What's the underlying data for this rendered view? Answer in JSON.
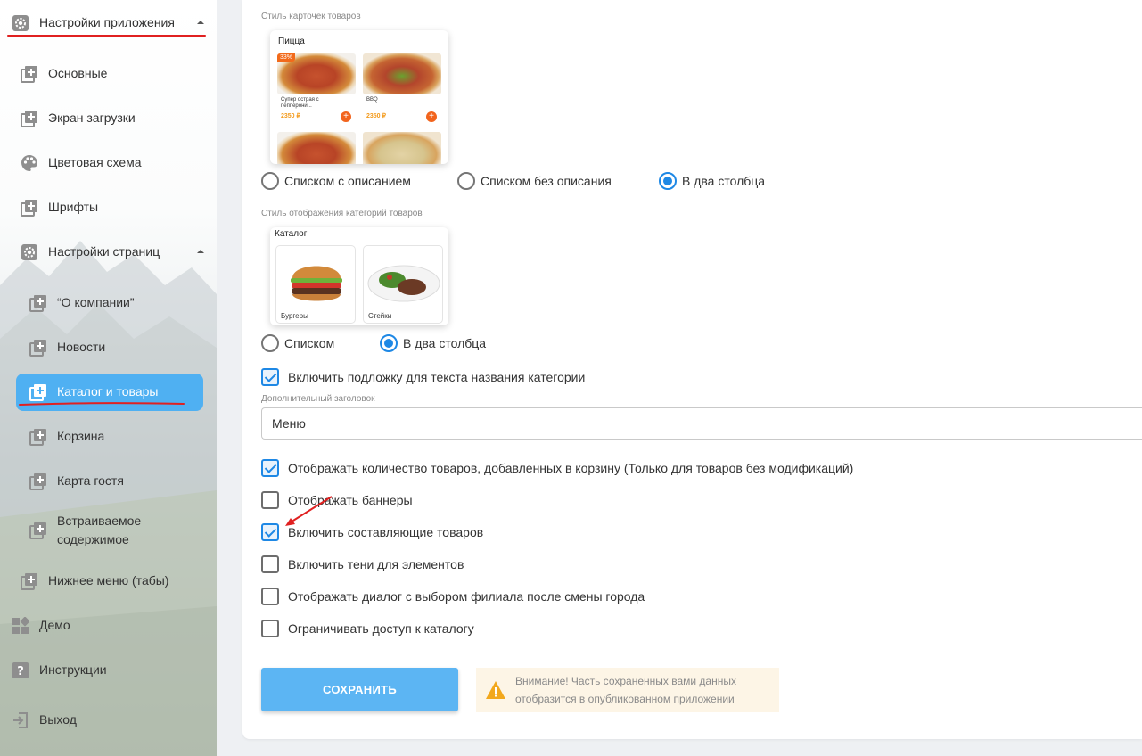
{
  "sidebar": {
    "app_settings": "Настройки приложения",
    "items": [
      {
        "label": "Основные"
      },
      {
        "label": "Экран загрузки"
      },
      {
        "label": "Цветовая схема"
      },
      {
        "label": "Шрифты"
      },
      {
        "label": "Настройки страниц"
      }
    ],
    "subitems": [
      {
        "label": "“О компании”"
      },
      {
        "label": "Новости"
      },
      {
        "label": "Каталог и товары"
      },
      {
        "label": "Корзина"
      },
      {
        "label": "Карта гостя"
      },
      {
        "label": "Встраиваемое содержимое"
      }
    ],
    "bottom_menu": "Нижнее меню (табы)",
    "demo": "Демо",
    "instructions": "Инструкции",
    "exit": "Выход"
  },
  "product_cards": {
    "caption": "Стиль карточек товаров",
    "preview": {
      "title": "Пицца",
      "badge": "33%",
      "card1_name": "Супер острая с пепперони...",
      "card1_price": "2350 ₽",
      "card2_name": "BBQ",
      "card2_price": "2350 ₽"
    },
    "options": [
      "Списком с описанием",
      "Списком без описания",
      "В два столбца"
    ],
    "selected": 2
  },
  "categories": {
    "caption": "Стиль отображения категорий товаров",
    "preview": {
      "title": "Каталог",
      "cat1": "Бургеры",
      "cat2": "Стейки"
    },
    "options": [
      "Списком",
      "В два столбца"
    ],
    "selected": 1
  },
  "checkbox_category_bg": {
    "label": "Включить подложку для текста названия категории",
    "checked": true
  },
  "extra_title": {
    "caption": "Дополнительный заголовок",
    "value": "Меню"
  },
  "checkboxes": [
    {
      "label": "Отображать количество товаров, добавленных в корзину (Только для товаров без модификаций)",
      "checked": true
    },
    {
      "label": "Отображать баннеры",
      "checked": false
    },
    {
      "label": "Включить составляющие товаров",
      "checked": true
    },
    {
      "label": "Включить тени для элементов",
      "checked": false
    },
    {
      "label": "Отображать диалог с выбором филиала после смены города",
      "checked": false
    },
    {
      "label": "Ограничивать доступ к каталогу",
      "checked": false
    }
  ],
  "save_button": "СОХРАНИТЬ",
  "warning": "Внимание! Часть сохраненных вами данных отобразится в опубликованном приложении",
  "colors": {
    "accent": "#4fb0f2",
    "radio_blue": "#1e88e5",
    "annotation_red": "#e02020"
  },
  "icons": [
    "gear-icon",
    "add-page-icon",
    "palette-icon",
    "dashboard-icon",
    "help-icon",
    "logout-icon",
    "warning-icon"
  ]
}
